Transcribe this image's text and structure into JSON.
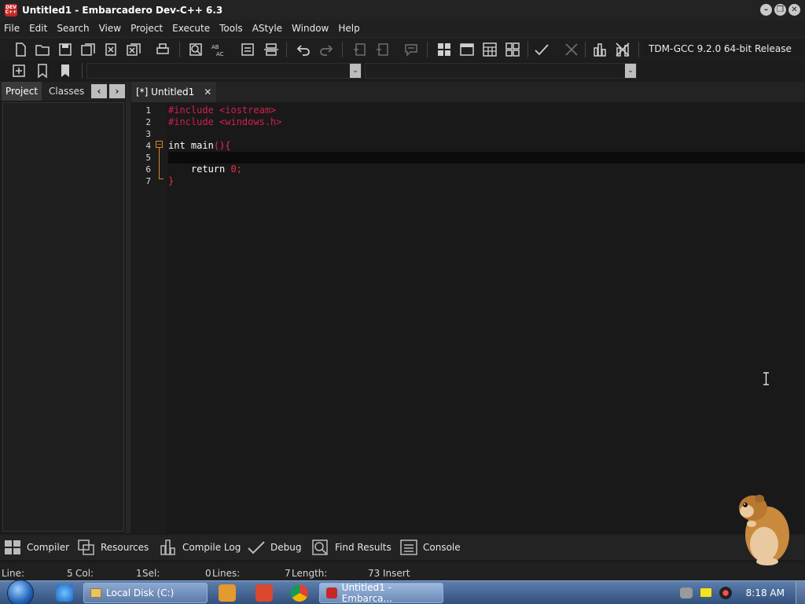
{
  "window": {
    "title": "Untitled1 - Embarcadero Dev-C++ 6.3",
    "app_icon_text": "DEV C++"
  },
  "menu": [
    "File",
    "Edit",
    "Search",
    "View",
    "Project",
    "Execute",
    "Tools",
    "AStyle",
    "Window",
    "Help"
  ],
  "toolbar": {
    "compiler": "TDM-GCC 9.2.0 64-bit Release"
  },
  "left_pane": {
    "tabs": [
      "Project",
      "Classes"
    ]
  },
  "editor": {
    "tab_label": "[*] Untitled1",
    "line_numbers": [
      "1",
      "2",
      "3",
      "4",
      "5",
      "6",
      "7"
    ],
    "code": {
      "l1_directive": "#include <iostream>",
      "l2_directive": "#include <windows.h>",
      "l4_type": "int",
      "l4_name": " main",
      "l4_punct": "(){",
      "l6_keyword": "    return ",
      "l6_num": "0",
      "l6_semi": ";",
      "l7_brace": "}"
    }
  },
  "bottom_tabs": [
    "Compiler",
    "Resources",
    "Compile Log",
    "Debug",
    "Find Results",
    "Console"
  ],
  "status": {
    "line_label": "Line:",
    "line": "5",
    "col_label": "Col:",
    "col": "1",
    "sel_label": "Sel:",
    "sel": "0",
    "lines_label": "Lines:",
    "lines": "7",
    "length_label": "Length:",
    "length": "73",
    "mode": "Insert"
  },
  "taskbar": {
    "explorer_task": "Local Disk (C:)",
    "devcpp_task": "Untitled1 - Embarca...",
    "time": "8:18 AM"
  },
  "colors": {
    "background": "#191919",
    "preprocessor": "#d41f4e",
    "keyword": "#ffffff",
    "fold": "#d28a2a"
  }
}
